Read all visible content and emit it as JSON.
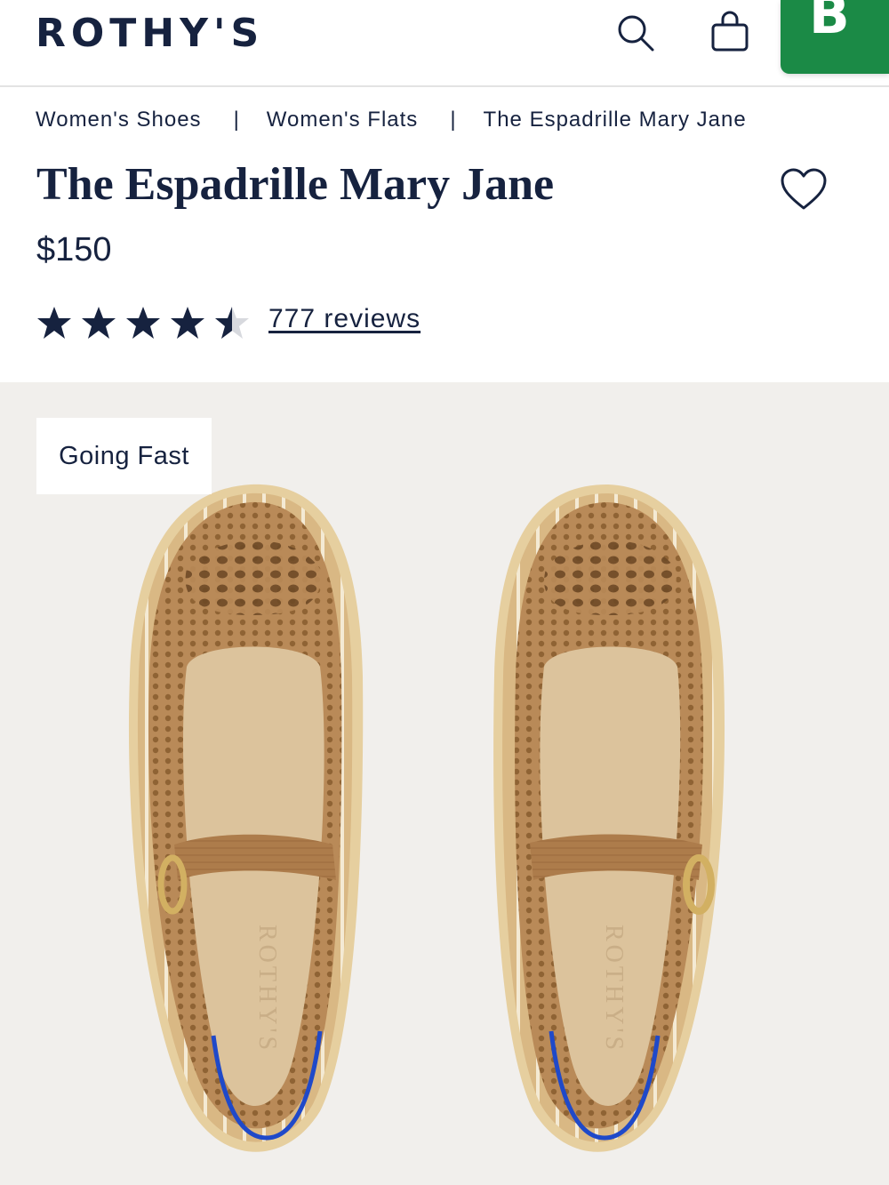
{
  "header": {
    "logo": "ROTHY'S",
    "badge_glyph": "B"
  },
  "breadcrumb": {
    "items": [
      "Women's Shoes",
      "Women's Flats",
      "The Espadrille Mary Jane"
    ],
    "separator": "|"
  },
  "product": {
    "title": "The Espadrille Mary Jane",
    "price": "$150",
    "rating": 4.5,
    "rating_max": 5,
    "reviews_label": "777 reviews"
  },
  "gallery": {
    "tag_label": "Going Fast",
    "insole_brand": "ROTHY'S"
  },
  "colors": {
    "navy": "#16223f",
    "green_badge": "#1b8a46",
    "gallery_bg": "#f1efec",
    "shoe_tan": "#b98a58",
    "sole": "#e6cf9f",
    "insole": "#dcc39c",
    "heel_accent": "#1f49c9"
  },
  "icons": {
    "search": "search-icon",
    "bag": "bag-icon",
    "wishlist": "heart-icon",
    "rating": "star-icon"
  }
}
